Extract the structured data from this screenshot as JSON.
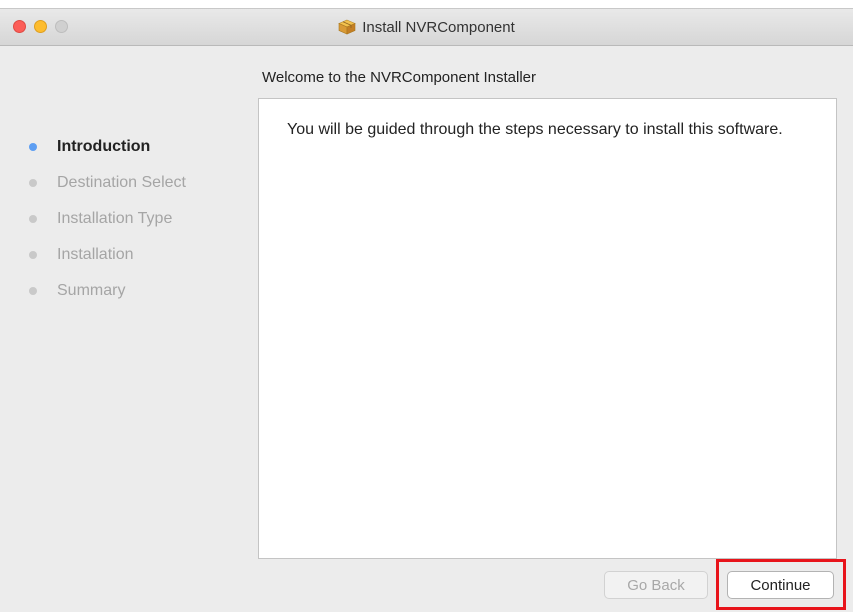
{
  "window": {
    "title": "Install NVRComponent",
    "title_icon": "package-icon"
  },
  "heading": "Welcome to the NVRComponent Installer",
  "steps": [
    {
      "label": "Introduction",
      "state": "current"
    },
    {
      "label": "Destination Select",
      "state": "pending"
    },
    {
      "label": "Installation Type",
      "state": "pending"
    },
    {
      "label": "Installation",
      "state": "pending"
    },
    {
      "label": "Summary",
      "state": "pending"
    }
  ],
  "content": {
    "text": "You will be guided through the steps necessary to install this software."
  },
  "buttons": {
    "go_back": "Go Back",
    "continue": "Continue"
  },
  "colors": {
    "current_step_dot": "#5d9ef2",
    "highlight_box": "#e8141b",
    "close_light": "#fc5d57",
    "minimize_light": "#fdbc2e"
  }
}
